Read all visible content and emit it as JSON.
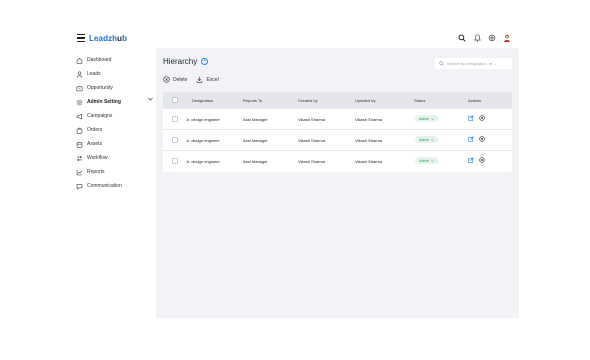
{
  "header": {
    "logo_part1": "Leadzh",
    "logo_part2": "u",
    "logo_part3": "b",
    "icons": [
      "menu-icon",
      "search-icon",
      "bell-icon",
      "settings-icon",
      "avatar"
    ]
  },
  "sidebar": {
    "items": [
      {
        "label": "Dashboard",
        "icon": "home-icon"
      },
      {
        "label": "Leads",
        "icon": "user-icon"
      },
      {
        "label": "Opportunity",
        "icon": "briefcase-icon"
      },
      {
        "label": "Admin Setting",
        "icon": "gear-icon",
        "active": true
      },
      {
        "label": "Campaigns",
        "icon": "megaphone-icon"
      },
      {
        "label": "Orders",
        "icon": "bag-icon"
      },
      {
        "label": "Assets",
        "icon": "box-icon"
      },
      {
        "label": "Workflow",
        "icon": "workflow-icon"
      },
      {
        "label": "Reports",
        "icon": "chart-icon"
      },
      {
        "label": "Communication",
        "icon": "chat-icon"
      }
    ]
  },
  "main": {
    "title": "Hierarchy",
    "search_placeholder": "Search by designation, re...",
    "toolbar": {
      "delete_label": "Delete",
      "excel_label": "Excel"
    },
    "table": {
      "columns": [
        "Designation",
        "Reports To",
        "Created by",
        "Updated by",
        "Status",
        "Actions"
      ],
      "rows": [
        {
          "designation": "Jr. design engineer",
          "reports_to": "Asst Manager",
          "created_by": "Vikash Sharma",
          "updated_by": "Vikash Sharma",
          "status": "Active"
        },
        {
          "designation": "Jr. design engineer",
          "reports_to": "Asst Manager",
          "created_by": "Vikash Sharma",
          "updated_by": "Vikash Sharma",
          "status": "Active"
        },
        {
          "designation": "Jr. design engineer",
          "reports_to": "Asst Manager",
          "created_by": "Vikash Sharma",
          "updated_by": "Vikash Sharma",
          "status": "Active"
        }
      ]
    }
  },
  "colors": {
    "accent": "#1e6fd9",
    "active_badge_bg": "#e6f4ec",
    "active_badge_text": "#1f9a55",
    "main_bg": "#f2f3f6",
    "table_header_bg": "#e4e6ec"
  }
}
